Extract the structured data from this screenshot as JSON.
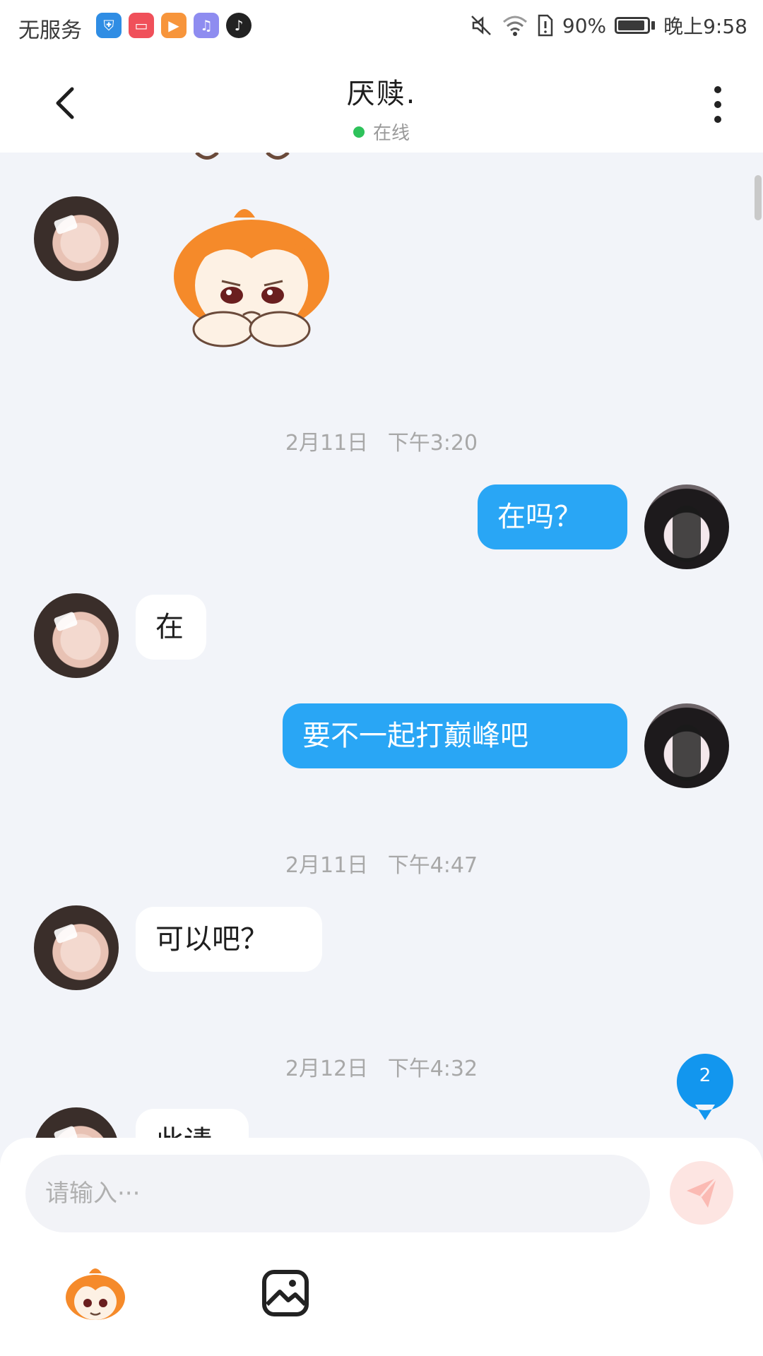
{
  "status_bar": {
    "carrier": "无服务",
    "battery": "90%",
    "time": "晚上9:58",
    "battery_level": 0.9
  },
  "header": {
    "title": "厌赎.",
    "status": "在线",
    "status_color": "#2ec25b"
  },
  "messages": [
    {
      "type": "sticker",
      "from": "other",
      "icon": "sticker-sad-girl"
    },
    {
      "type": "timestamp",
      "text": "2月11日  下午3:20"
    },
    {
      "type": "text",
      "from": "self",
      "text": "在吗？"
    },
    {
      "type": "text",
      "from": "other",
      "text": "在"
    },
    {
      "type": "text",
      "from": "self",
      "text": "要不一起打巅峰吧"
    },
    {
      "type": "timestamp",
      "text": "2月11日  下午4:47"
    },
    {
      "type": "text",
      "from": "other",
      "text": "可以吧？"
    },
    {
      "type": "timestamp",
      "text": "2月12日  下午4:32"
    },
    {
      "type": "text",
      "from": "other",
      "text": "此请"
    }
  ],
  "unread_badge": "2",
  "input": {
    "placeholder": "请输入···"
  },
  "colors": {
    "accent": "#29a6f5",
    "page_background": "#f2f4f9",
    "send_button_bg": "#fde5e2"
  },
  "icons": {
    "back": "chevron-left-icon",
    "more": "more-vertical-icon",
    "send": "paper-plane-icon",
    "emoji": "mascot-emoji-icon",
    "image": "image-icon"
  }
}
